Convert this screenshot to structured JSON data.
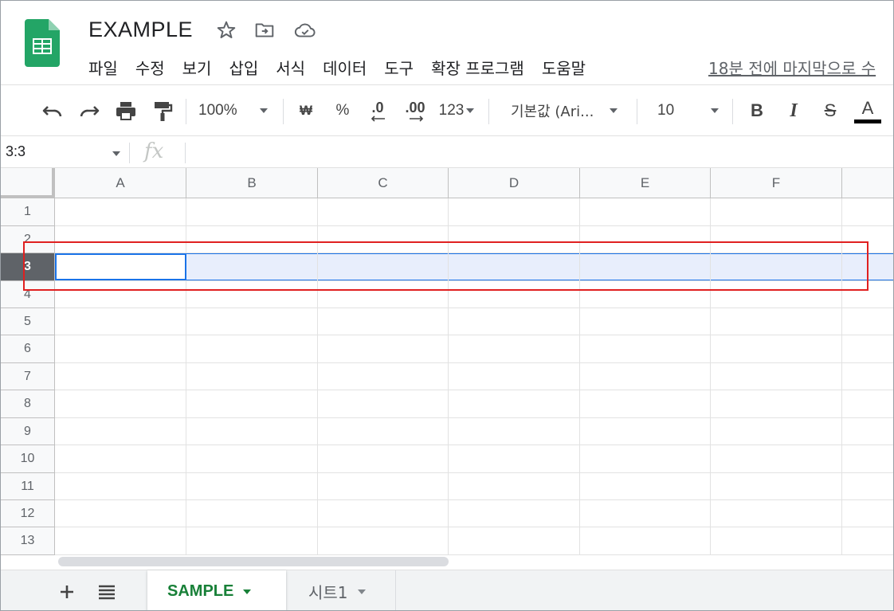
{
  "header": {
    "doc_title": "EXAMPLE",
    "star_icon": "star-icon",
    "move_icon": "move-to-folder-icon",
    "cloud_icon": "cloud-saved-icon",
    "menu": [
      "파일",
      "수정",
      "보기",
      "삽입",
      "서식",
      "데이터",
      "도구",
      "확장 프로그램",
      "도움말"
    ],
    "last_edit": "18분 전에 마지막으로 수"
  },
  "toolbar": {
    "zoom": "100%",
    "currency": "₩",
    "percent": "%",
    "decrease_decimal": ".0",
    "increase_decimal": ".00",
    "more_formats": "123",
    "font": "기본값 (Ari...",
    "font_size": "10",
    "bold": "B",
    "italic": "I",
    "strike": "S",
    "text_color": "A",
    "text_color_value": "#000000"
  },
  "formula_bar": {
    "name_box": "3:3",
    "fx": "fx",
    "value": ""
  },
  "grid": {
    "columns": [
      "A",
      "B",
      "C",
      "D",
      "E",
      "F"
    ],
    "rows": [
      "1",
      "2",
      "3",
      "4",
      "5",
      "6",
      "7",
      "8",
      "9",
      "10",
      "11",
      "12",
      "13"
    ],
    "selected_row": "3",
    "active_cell": "A3"
  },
  "sheets": {
    "tabs": [
      {
        "label": "SAMPLE",
        "active": true
      },
      {
        "label": "시트1",
        "active": false
      }
    ]
  },
  "colors": {
    "accent": "#1a73e8",
    "selection_fill": "#e8eefc",
    "annotation": "#e02020",
    "active_tab": "#188038"
  }
}
